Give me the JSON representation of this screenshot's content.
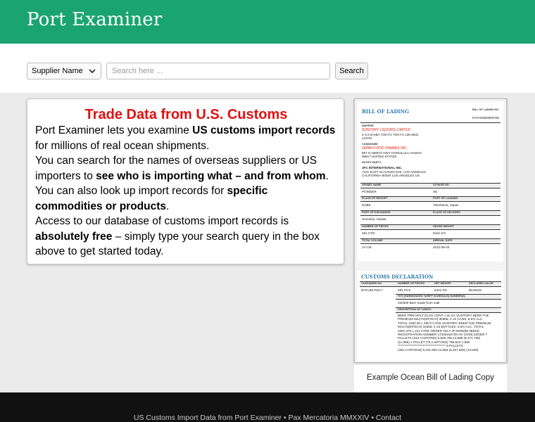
{
  "header": {
    "brand": "Port Examiner"
  },
  "search": {
    "type_selected": "Supplier Name",
    "placeholder": "Search here ...",
    "button_label": "Search"
  },
  "intro": {
    "title": "Trade Data from U.S. Customs",
    "p1_a": "Port Examiner lets you examine ",
    "p1_b": "US customs import records",
    "p1_c": " for millions of real ocean shipments.",
    "p2_a": "You can search for the names of overseas suppliers or US importers to ",
    "p2_b": "see who is importing what – and from whom",
    "p2_c": ".",
    "p3_a": "You can also look up import records for ",
    "p3_b": "specific commodities or products",
    "p3_c": ".",
    "p4_a": "Access to our database of customs import records is ",
    "p4_b": "absolutely free",
    "p4_c": " – simply type your search query in the box above to get started today."
  },
  "sample": {
    "caption": "Example Ocean Bill of Lading Copy",
    "bol": {
      "title": "BILL OF LADING",
      "bl_no_label": "BILL OF LADING NO.",
      "bl_no": "NYKS0660005760",
      "shipper_label": "SHIPPER",
      "shipper_name": "SUNTORY LIQUORS LIMITED",
      "shipper_addr1": "2-3-3 DAIBA TOKYO TOKYO 135-8631",
      "shipper_addr2": "JAPAN",
      "consignee_label": "CONSIGNEE",
      "consignee_name": "JAPAN FOOD (HAWAII) INC.",
      "consignee_addr1": "867 N NIMITZ HWY HONOLULU HAWAII",
      "consignee_addr2": "96817 UNITED STATES",
      "notify_label": "NOTIFY PARTY",
      "notify_name": "JFC INTERNATIONAL INC.",
      "notify_addr1": "7101 EAST SLAUSON AVE. LOS ANGELES",
      "notify_addr2": "CALIFORNIA 90040 LOS ANGELES US",
      "vessel_label": "VESSEL NAME",
      "vessel": "PIONEER",
      "voyage_label": "VOYAGE NO.",
      "voyage": "SE",
      "receipt_label": "PLACE OF RECEIPT",
      "receipt": "KOBE",
      "loading_label": "PORT OF LOADING",
      "loading": "Yokohama, Japan",
      "discharge_label": "PORT OF DISCHARGE",
      "discharge": "Honolulu, Hawaii",
      "delivery_label": "PLACE OF DELIVERY",
      "delivery": "",
      "pieces_label": "NUMBER OF PIECES",
      "pieces": "491 CTN",
      "gross_label": "GROSS WEIGHT",
      "gross": "6421 KG",
      "volume_label": "TOTAL VOLUME",
      "volume": "14 CM",
      "arrival_label": "ARRIVAL DATE",
      "arrival": "2012-09-24"
    },
    "customs": {
      "title": "CUSTOMS DECLARATION",
      "container_label": "CONTAINER NO.",
      "container": "NYKU8176417",
      "pieces_label": "NUMBER OF PIECES",
      "pieces": "491 PCS",
      "weight_label": "NET WEIGHT",
      "weight": "6421 KG",
      "value_label": "DECLARED VALUE",
      "value": "$128432",
      "hts_label": "HTS (HARMONIZED TARIFF SCHEDULE) NUMBER(S)",
      "hts": "220300 Beer made from malt",
      "cargo_label": "DESCRIPTION OF CARGO",
      "cargo_lines": [
        "BEER PRM MALT,GLSS CONT=<4L EA SUNTORY BEER THE",
        "PREMIUM MALTS(EPOCH) 350ML X 24 CANS, 5.5% ALC.",
        "TOTAL 2352.00 L 28C0 CTNS SUNTORY BEER THE PREMIUM",
        "MALTS(EPOCH) 334ML X 24 BOTTLES, 5.5% ALC. TOTAL",
        "1691.376 L 211 CTNS ORDER NO.# JF-0030(98-48923)",
        "REGISTRATION NUMBER 17340156728 HS CODE:220300 7",
        "PALLETS (416 CARTONS) 5,625.790 12.588 (5,471.790)",
        "(11.988) 1 PALLET (75 CARTONS) 795.810 1.596",
        "************************************** 8 PALLETS",
        "(491 CARTONS) 6,421.600 14.556 (6,267.600) (13.548)"
      ]
    }
  },
  "footer": {
    "text": "US Customs Import Data from Port Examiner • Pax Mercatoria MMXXIV • Contact"
  },
  "colors": {
    "brand_green": "#1aa472",
    "title_red": "#e01010",
    "footer_bg": "#111111"
  }
}
